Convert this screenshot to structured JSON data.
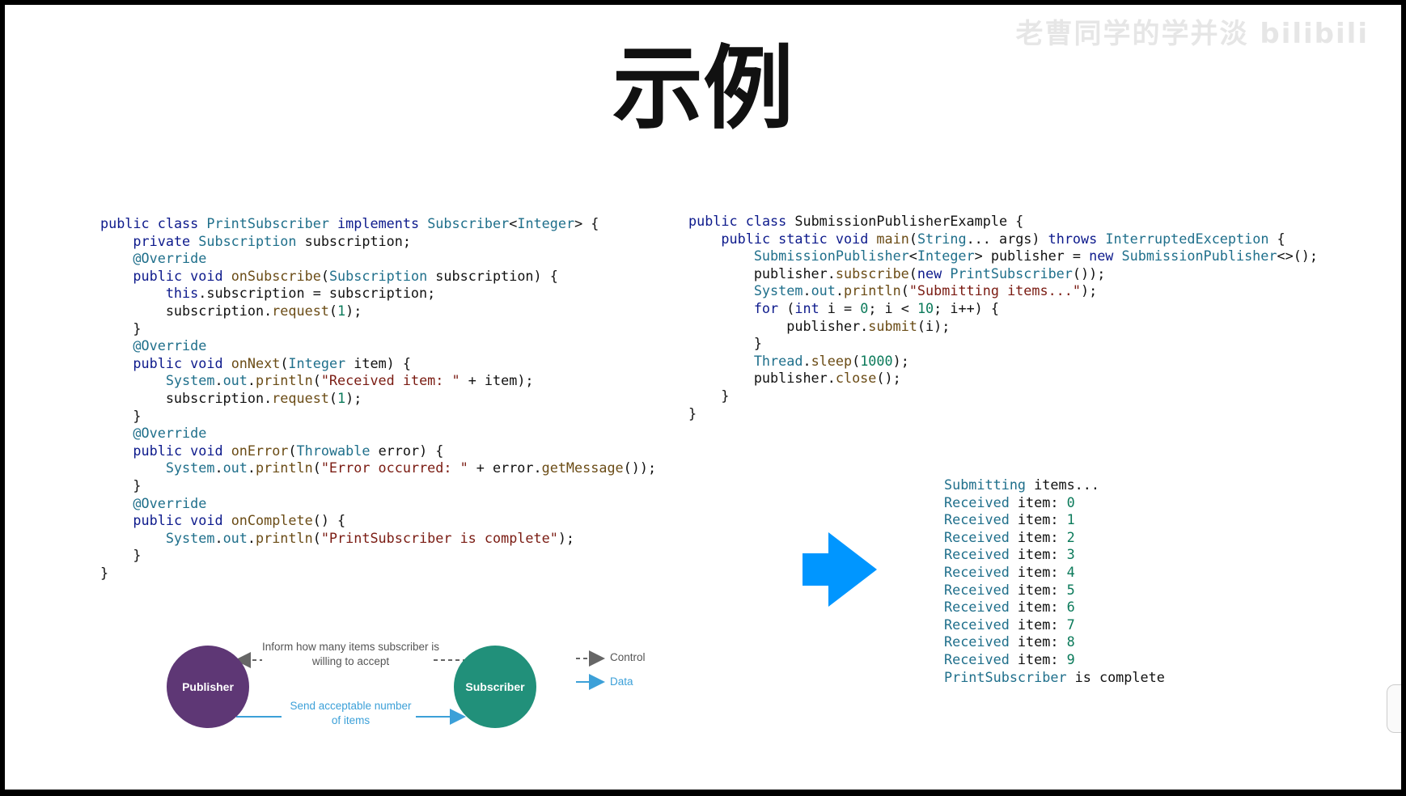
{
  "slide": {
    "title": "示例",
    "watermark": "老曹同学的学并淡 bilibili"
  },
  "code_left": {
    "lines": [
      "public class PrintSubscriber implements Subscriber<Integer> {",
      "    private Subscription subscription;",
      "    @Override",
      "    public void onSubscribe(Subscription subscription) {",
      "        this.subscription = subscription;",
      "        subscription.request(1);",
      "    }",
      "    @Override",
      "    public void onNext(Integer item) {",
      "        System.out.println(\"Received item: \" + item);",
      "        subscription.request(1);",
      "    }",
      "    @Override",
      "    public void onError(Throwable error) {",
      "        System.out.println(\"Error occurred: \" + error.getMessage());",
      "    }",
      "    @Override",
      "    public void onComplete() {",
      "        System.out.println(\"PrintSubscriber is complete\");",
      "    }",
      "}"
    ]
  },
  "code_right": {
    "lines": [
      "public class SubmissionPublisherExample {",
      "    public static void main(String... args) throws InterruptedException {",
      "        SubmissionPublisher<Integer> publisher = new SubmissionPublisher<>();",
      "        publisher.subscribe(new PrintSubscriber());",
      "        System.out.println(\"Submitting items...\");",
      "        for (int i = 0; i < 10; i++) {",
      "            publisher.submit(i);",
      "        }",
      "        Thread.sleep(1000);",
      "        publisher.close();",
      "    }",
      "}"
    ]
  },
  "output": {
    "lines": [
      "Submitting items...",
      "Received item: 0",
      "Received item: 1",
      "Received item: 2",
      "Received item: 3",
      "Received item: 4",
      "Received item: 5",
      "Received item: 6",
      "Received item: 7",
      "Received item: 8",
      "Received item: 9",
      "PrintSubscriber is complete"
    ]
  },
  "arrow": {
    "icon": "right-arrow-icon",
    "color": "#0096ff"
  },
  "diagram": {
    "publisher_label": "Publisher",
    "subscriber_label": "Subscriber",
    "control_text": "Inform how many items subscriber is willing to accept",
    "data_text": "Send acceptable number of items",
    "legend_control": "Control",
    "legend_data": "Data",
    "publisher_color": "#5e3775",
    "subscriber_color": "#21907a",
    "data_color": "#3ca0d8",
    "control_color": "#666666"
  }
}
